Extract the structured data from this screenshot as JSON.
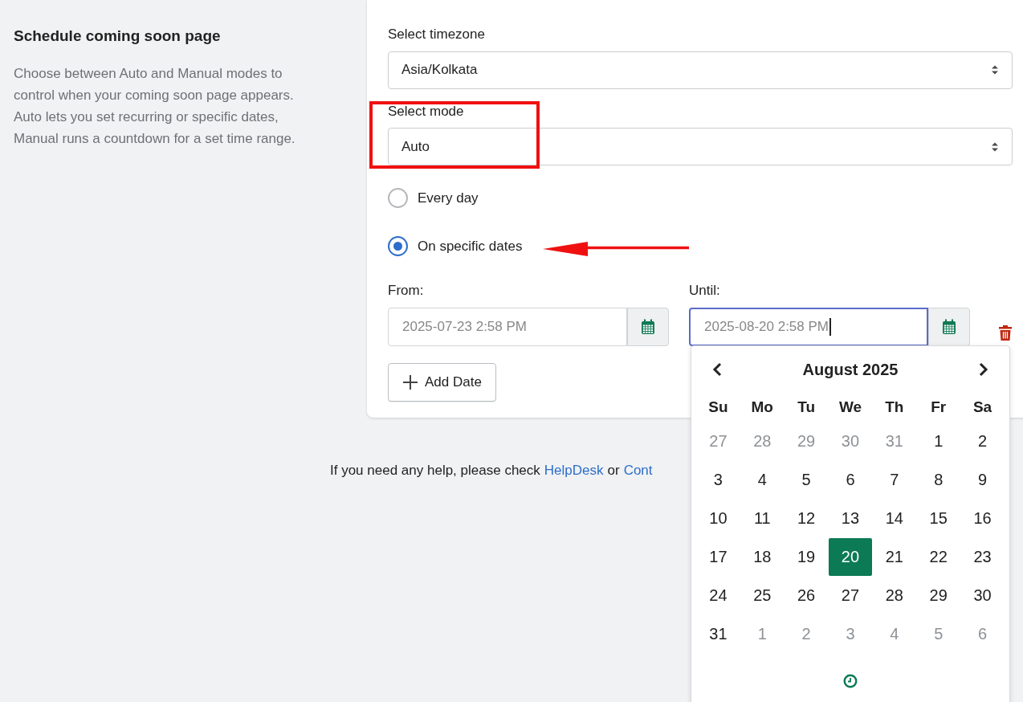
{
  "intro": {
    "title": "Schedule coming soon page",
    "description": "Choose between Auto and Manual modes to control when your coming soon page appears. Auto lets you set recurring or specific dates, Manual runs a countdown for a set time range."
  },
  "timezone": {
    "label": "Select timezone",
    "value": "Asia/Kolkata"
  },
  "mode": {
    "label": "Select mode",
    "value": "Auto"
  },
  "options": [
    {
      "label": "Every day",
      "selected": false
    },
    {
      "label": "On specific dates",
      "selected": true
    }
  ],
  "from": {
    "label": "From:",
    "value": "2025-07-23 2:58 PM",
    "focused": false
  },
  "until": {
    "label": "Until:",
    "value": "2025-08-20 2:58 PM",
    "focused": true
  },
  "add_button": "Add Date",
  "help": {
    "text": "If you need any help, please check",
    "link": "HelpDesk",
    "joiner": "or",
    "link2": "Cont"
  },
  "calendar": {
    "title": "August 2025",
    "weekdays": [
      "Su",
      "Mo",
      "Tu",
      "We",
      "Th",
      "Fr",
      "Sa"
    ],
    "weeks": [
      [
        {
          "label": "27",
          "muted": true,
          "selected": false
        },
        {
          "label": "28",
          "muted": true,
          "selected": false
        },
        {
          "label": "29",
          "muted": true,
          "selected": false
        },
        {
          "label": "30",
          "muted": true,
          "selected": false
        },
        {
          "label": "31",
          "muted": true,
          "selected": false
        },
        {
          "label": "1",
          "muted": false,
          "selected": false
        },
        {
          "label": "2",
          "muted": false,
          "selected": false
        }
      ],
      [
        {
          "label": "3",
          "muted": false,
          "selected": false
        },
        {
          "label": "4",
          "muted": false,
          "selected": false
        },
        {
          "label": "5",
          "muted": false,
          "selected": false
        },
        {
          "label": "6",
          "muted": false,
          "selected": false
        },
        {
          "label": "7",
          "muted": false,
          "selected": false
        },
        {
          "label": "8",
          "muted": false,
          "selected": false
        },
        {
          "label": "9",
          "muted": false,
          "selected": false
        }
      ],
      [
        {
          "label": "10",
          "muted": false,
          "selected": false
        },
        {
          "label": "11",
          "muted": false,
          "selected": false
        },
        {
          "label": "12",
          "muted": false,
          "selected": false
        },
        {
          "label": "13",
          "muted": false,
          "selected": false
        },
        {
          "label": "14",
          "muted": false,
          "selected": false
        },
        {
          "label": "15",
          "muted": false,
          "selected": false
        },
        {
          "label": "16",
          "muted": false,
          "selected": false
        }
      ],
      [
        {
          "label": "17",
          "muted": false,
          "selected": false
        },
        {
          "label": "18",
          "muted": false,
          "selected": false
        },
        {
          "label": "19",
          "muted": false,
          "selected": false
        },
        {
          "label": "20",
          "muted": false,
          "selected": true
        },
        {
          "label": "21",
          "muted": false,
          "selected": false
        },
        {
          "label": "22",
          "muted": false,
          "selected": false
        },
        {
          "label": "23",
          "muted": false,
          "selected": false
        }
      ],
      [
        {
          "label": "24",
          "muted": false,
          "selected": false
        },
        {
          "label": "25",
          "muted": false,
          "selected": false
        },
        {
          "label": "26",
          "muted": false,
          "selected": false
        },
        {
          "label": "27",
          "muted": false,
          "selected": false
        },
        {
          "label": "28",
          "muted": false,
          "selected": false
        },
        {
          "label": "29",
          "muted": false,
          "selected": false
        },
        {
          "label": "30",
          "muted": false,
          "selected": false
        }
      ],
      [
        {
          "label": "31",
          "muted": false,
          "selected": false
        },
        {
          "label": "1",
          "muted": true,
          "selected": false
        },
        {
          "label": "2",
          "muted": true,
          "selected": false
        },
        {
          "label": "3",
          "muted": true,
          "selected": false
        },
        {
          "label": "4",
          "muted": true,
          "selected": false
        },
        {
          "label": "5",
          "muted": true,
          "selected": false
        },
        {
          "label": "6",
          "muted": true,
          "selected": false
        }
      ]
    ]
  }
}
